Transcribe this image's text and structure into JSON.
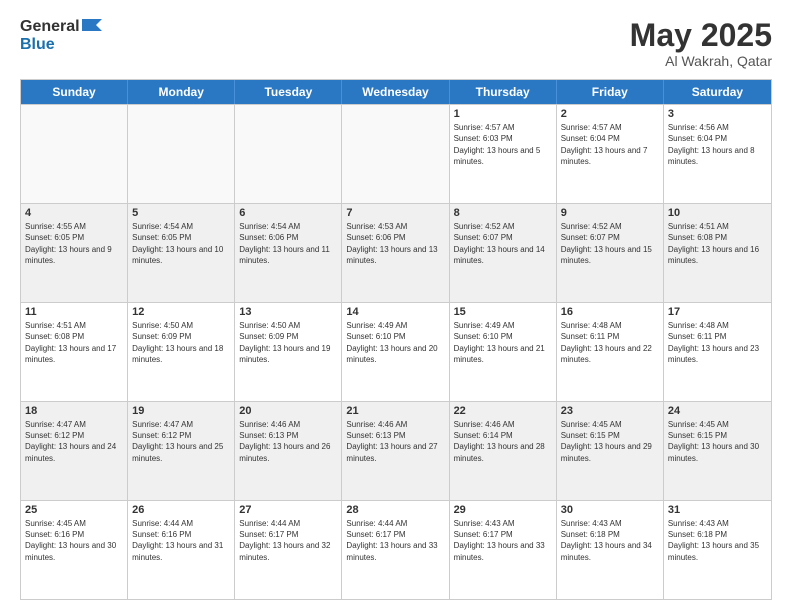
{
  "logo": {
    "line1": "General",
    "line2": "Blue"
  },
  "title": {
    "month_year": "May 2025",
    "location": "Al Wakrah, Qatar"
  },
  "header_days": [
    "Sunday",
    "Monday",
    "Tuesday",
    "Wednesday",
    "Thursday",
    "Friday",
    "Saturday"
  ],
  "weeks": [
    [
      {
        "day": "",
        "info": "",
        "empty": true
      },
      {
        "day": "",
        "info": "",
        "empty": true
      },
      {
        "day": "",
        "info": "",
        "empty": true
      },
      {
        "day": "",
        "info": "",
        "empty": true
      },
      {
        "day": "1",
        "info": "Sunrise: 4:57 AM\nSunset: 6:03 PM\nDaylight: 13 hours and 5 minutes.",
        "empty": false
      },
      {
        "day": "2",
        "info": "Sunrise: 4:57 AM\nSunset: 6:04 PM\nDaylight: 13 hours and 7 minutes.",
        "empty": false
      },
      {
        "day": "3",
        "info": "Sunrise: 4:56 AM\nSunset: 6:04 PM\nDaylight: 13 hours and 8 minutes.",
        "empty": false
      }
    ],
    [
      {
        "day": "4",
        "info": "Sunrise: 4:55 AM\nSunset: 6:05 PM\nDaylight: 13 hours and 9 minutes.",
        "empty": false,
        "shaded": true
      },
      {
        "day": "5",
        "info": "Sunrise: 4:54 AM\nSunset: 6:05 PM\nDaylight: 13 hours and 10 minutes.",
        "empty": false,
        "shaded": true
      },
      {
        "day": "6",
        "info": "Sunrise: 4:54 AM\nSunset: 6:06 PM\nDaylight: 13 hours and 11 minutes.",
        "empty": false,
        "shaded": true
      },
      {
        "day": "7",
        "info": "Sunrise: 4:53 AM\nSunset: 6:06 PM\nDaylight: 13 hours and 13 minutes.",
        "empty": false,
        "shaded": true
      },
      {
        "day": "8",
        "info": "Sunrise: 4:52 AM\nSunset: 6:07 PM\nDaylight: 13 hours and 14 minutes.",
        "empty": false,
        "shaded": true
      },
      {
        "day": "9",
        "info": "Sunrise: 4:52 AM\nSunset: 6:07 PM\nDaylight: 13 hours and 15 minutes.",
        "empty": false,
        "shaded": true
      },
      {
        "day": "10",
        "info": "Sunrise: 4:51 AM\nSunset: 6:08 PM\nDaylight: 13 hours and 16 minutes.",
        "empty": false,
        "shaded": true
      }
    ],
    [
      {
        "day": "11",
        "info": "Sunrise: 4:51 AM\nSunset: 6:08 PM\nDaylight: 13 hours and 17 minutes.",
        "empty": false
      },
      {
        "day": "12",
        "info": "Sunrise: 4:50 AM\nSunset: 6:09 PM\nDaylight: 13 hours and 18 minutes.",
        "empty": false
      },
      {
        "day": "13",
        "info": "Sunrise: 4:50 AM\nSunset: 6:09 PM\nDaylight: 13 hours and 19 minutes.",
        "empty": false
      },
      {
        "day": "14",
        "info": "Sunrise: 4:49 AM\nSunset: 6:10 PM\nDaylight: 13 hours and 20 minutes.",
        "empty": false
      },
      {
        "day": "15",
        "info": "Sunrise: 4:49 AM\nSunset: 6:10 PM\nDaylight: 13 hours and 21 minutes.",
        "empty": false
      },
      {
        "day": "16",
        "info": "Sunrise: 4:48 AM\nSunset: 6:11 PM\nDaylight: 13 hours and 22 minutes.",
        "empty": false
      },
      {
        "day": "17",
        "info": "Sunrise: 4:48 AM\nSunset: 6:11 PM\nDaylight: 13 hours and 23 minutes.",
        "empty": false
      }
    ],
    [
      {
        "day": "18",
        "info": "Sunrise: 4:47 AM\nSunset: 6:12 PM\nDaylight: 13 hours and 24 minutes.",
        "empty": false,
        "shaded": true
      },
      {
        "day": "19",
        "info": "Sunrise: 4:47 AM\nSunset: 6:12 PM\nDaylight: 13 hours and 25 minutes.",
        "empty": false,
        "shaded": true
      },
      {
        "day": "20",
        "info": "Sunrise: 4:46 AM\nSunset: 6:13 PM\nDaylight: 13 hours and 26 minutes.",
        "empty": false,
        "shaded": true
      },
      {
        "day": "21",
        "info": "Sunrise: 4:46 AM\nSunset: 6:13 PM\nDaylight: 13 hours and 27 minutes.",
        "empty": false,
        "shaded": true
      },
      {
        "day": "22",
        "info": "Sunrise: 4:46 AM\nSunset: 6:14 PM\nDaylight: 13 hours and 28 minutes.",
        "empty": false,
        "shaded": true
      },
      {
        "day": "23",
        "info": "Sunrise: 4:45 AM\nSunset: 6:15 PM\nDaylight: 13 hours and 29 minutes.",
        "empty": false,
        "shaded": true
      },
      {
        "day": "24",
        "info": "Sunrise: 4:45 AM\nSunset: 6:15 PM\nDaylight: 13 hours and 30 minutes.",
        "empty": false,
        "shaded": true
      }
    ],
    [
      {
        "day": "25",
        "info": "Sunrise: 4:45 AM\nSunset: 6:16 PM\nDaylight: 13 hours and 30 minutes.",
        "empty": false
      },
      {
        "day": "26",
        "info": "Sunrise: 4:44 AM\nSunset: 6:16 PM\nDaylight: 13 hours and 31 minutes.",
        "empty": false
      },
      {
        "day": "27",
        "info": "Sunrise: 4:44 AM\nSunset: 6:17 PM\nDaylight: 13 hours and 32 minutes.",
        "empty": false
      },
      {
        "day": "28",
        "info": "Sunrise: 4:44 AM\nSunset: 6:17 PM\nDaylight: 13 hours and 33 minutes.",
        "empty": false
      },
      {
        "day": "29",
        "info": "Sunrise: 4:43 AM\nSunset: 6:17 PM\nDaylight: 13 hours and 33 minutes.",
        "empty": false
      },
      {
        "day": "30",
        "info": "Sunrise: 4:43 AM\nSunset: 6:18 PM\nDaylight: 13 hours and 34 minutes.",
        "empty": false
      },
      {
        "day": "31",
        "info": "Sunrise: 4:43 AM\nSunset: 6:18 PM\nDaylight: 13 hours and 35 minutes.",
        "empty": false
      }
    ]
  ]
}
